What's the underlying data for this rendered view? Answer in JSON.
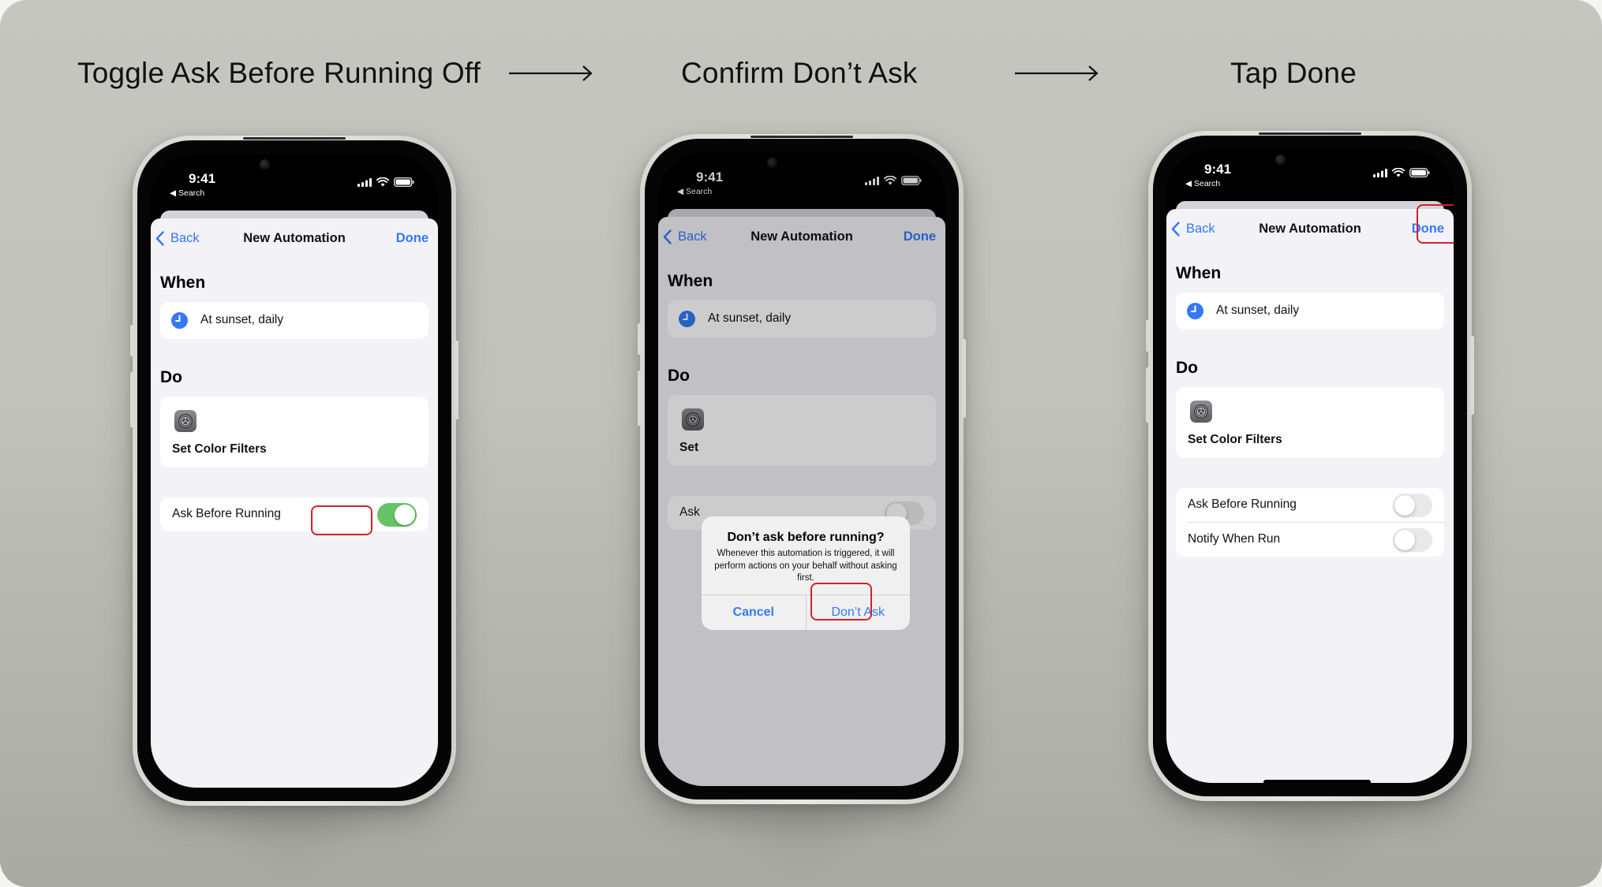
{
  "accent_color": "#3478f6",
  "highlight_color": "#d0222a",
  "toggle_on_color": "#65c466",
  "steps": [
    {
      "title": "Toggle Ask Before Running Off",
      "status_bar": {
        "time": "9:41",
        "back_app": "Search",
        "icons": [
          "signal-icon",
          "wifi-icon",
          "battery-icon"
        ]
      },
      "nav": {
        "back": "Back",
        "title": "New Automation",
        "done": "Done"
      },
      "when": {
        "heading": "When",
        "trigger": "At sunset, daily",
        "icon": "clock-icon"
      },
      "do": {
        "heading": "Do",
        "action": "Set Color Filters",
        "icon": "settings-icon"
      },
      "toggles": [
        {
          "label": "Ask Before Running",
          "on": true
        }
      ],
      "highlight": "ask-before-running-toggle"
    },
    {
      "title": "Confirm Don’t Ask",
      "status_bar": {
        "time": "9:41",
        "back_app": "Search",
        "icons": [
          "signal-icon",
          "wifi-icon",
          "battery-icon"
        ]
      },
      "nav": {
        "back": "Back",
        "title": "New Automation",
        "done": "Done"
      },
      "when": {
        "heading": "When",
        "trigger": "At sunset, daily",
        "icon": "clock-icon"
      },
      "do": {
        "heading": "Do",
        "action_partial": "Set",
        "icon": "settings-icon"
      },
      "toggles": [
        {
          "label_partial": "Ask",
          "on": false
        }
      ],
      "alert": {
        "title": "Don’t ask before running?",
        "message": "Whenever this automation is triggered, it will perform actions on your behalf without asking first.",
        "cancel": "Cancel",
        "confirm": "Don’t Ask"
      },
      "highlight": "dont-ask-button"
    },
    {
      "title": "Tap Done",
      "status_bar": {
        "time": "9:41",
        "back_app": "Search",
        "icons": [
          "signal-icon",
          "wifi-icon",
          "battery-icon"
        ]
      },
      "nav": {
        "back": "Back",
        "title": "New Automation",
        "done": "Done"
      },
      "when": {
        "heading": "When",
        "trigger": "At sunset, daily",
        "icon": "clock-icon"
      },
      "do": {
        "heading": "Do",
        "action": "Set Color Filters",
        "icon": "settings-icon"
      },
      "toggles": [
        {
          "label": "Ask Before Running",
          "on": false
        },
        {
          "label": "Notify When Run",
          "on": false
        }
      ],
      "highlight": "done-button"
    }
  ]
}
